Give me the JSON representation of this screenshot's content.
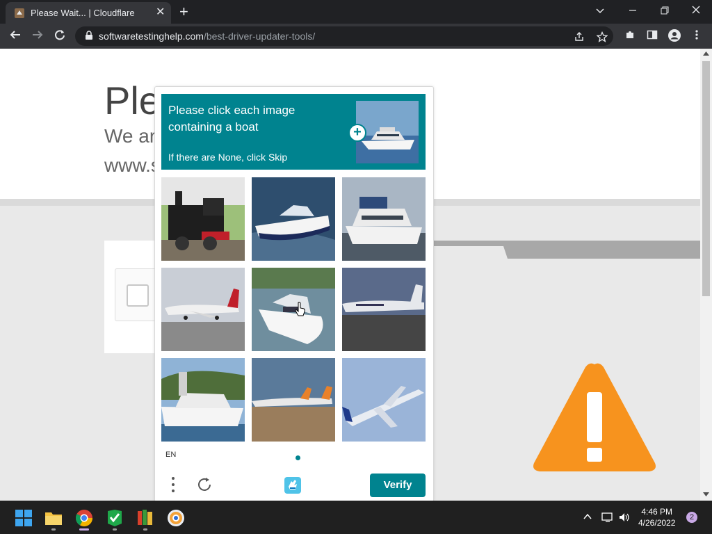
{
  "browser": {
    "tab_title": "Please Wait... | Cloudflare",
    "close_tab_glyph": "✕",
    "new_tab_glyph": "+",
    "url_host": "softwaretestinghelp.com",
    "url_path": "/best-driver-updater-tools/"
  },
  "page": {
    "heading": "Ple",
    "subline": "We ar",
    "site": "www.s"
  },
  "captcha": {
    "prompt_line": "Please click each image containing a boat",
    "prompt_sub": "If there are None, click Skip",
    "lang": "EN",
    "verify_label": "Verify",
    "tiles": [
      {
        "subject": "train"
      },
      {
        "subject": "speedboat"
      },
      {
        "subject": "yacht"
      },
      {
        "subject": "airplane"
      },
      {
        "subject": "speedboat"
      },
      {
        "subject": "airplane"
      },
      {
        "subject": "yacht"
      },
      {
        "subject": "airplane"
      },
      {
        "subject": "airplane"
      }
    ]
  },
  "taskbar": {
    "time": "4:46 PM",
    "date": "4/26/2022",
    "notifications": "2"
  },
  "colors": {
    "accent": "#00838f",
    "warning": "#f7931e"
  }
}
